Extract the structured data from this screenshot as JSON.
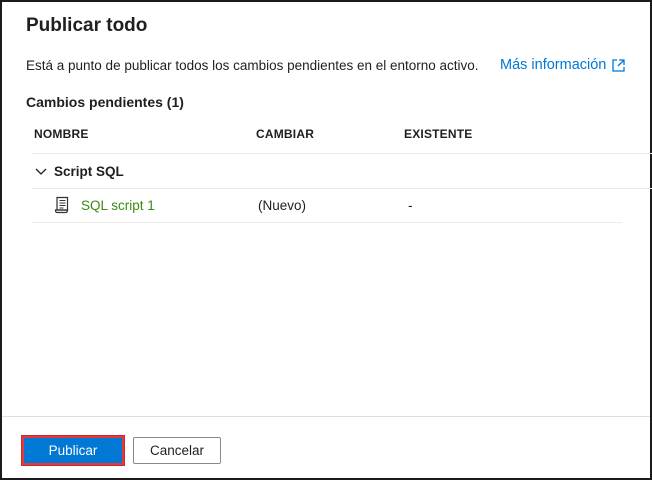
{
  "dialog": {
    "title": "Publicar todo",
    "description": "Está a punto de publicar todos los cambios pendientes en el entorno activo.",
    "more_info_label": "Más información"
  },
  "pending": {
    "title": "Cambios pendientes (1)",
    "columns": {
      "name": "NOMBRE",
      "change": "CAMBIAR",
      "existing": "EXISTENTE"
    },
    "groups": [
      {
        "label": "Script SQL",
        "rows": [
          {
            "name": "SQL script 1",
            "change": "(Nuevo)",
            "existing": "-"
          }
        ]
      }
    ]
  },
  "footer": {
    "publish_label": "Publicar",
    "cancel_label": "Cancelar"
  },
  "colors": {
    "accent": "#0078d4",
    "link": "#0078d4",
    "item_name": "#3d8a10",
    "highlight": "#e0393e"
  }
}
